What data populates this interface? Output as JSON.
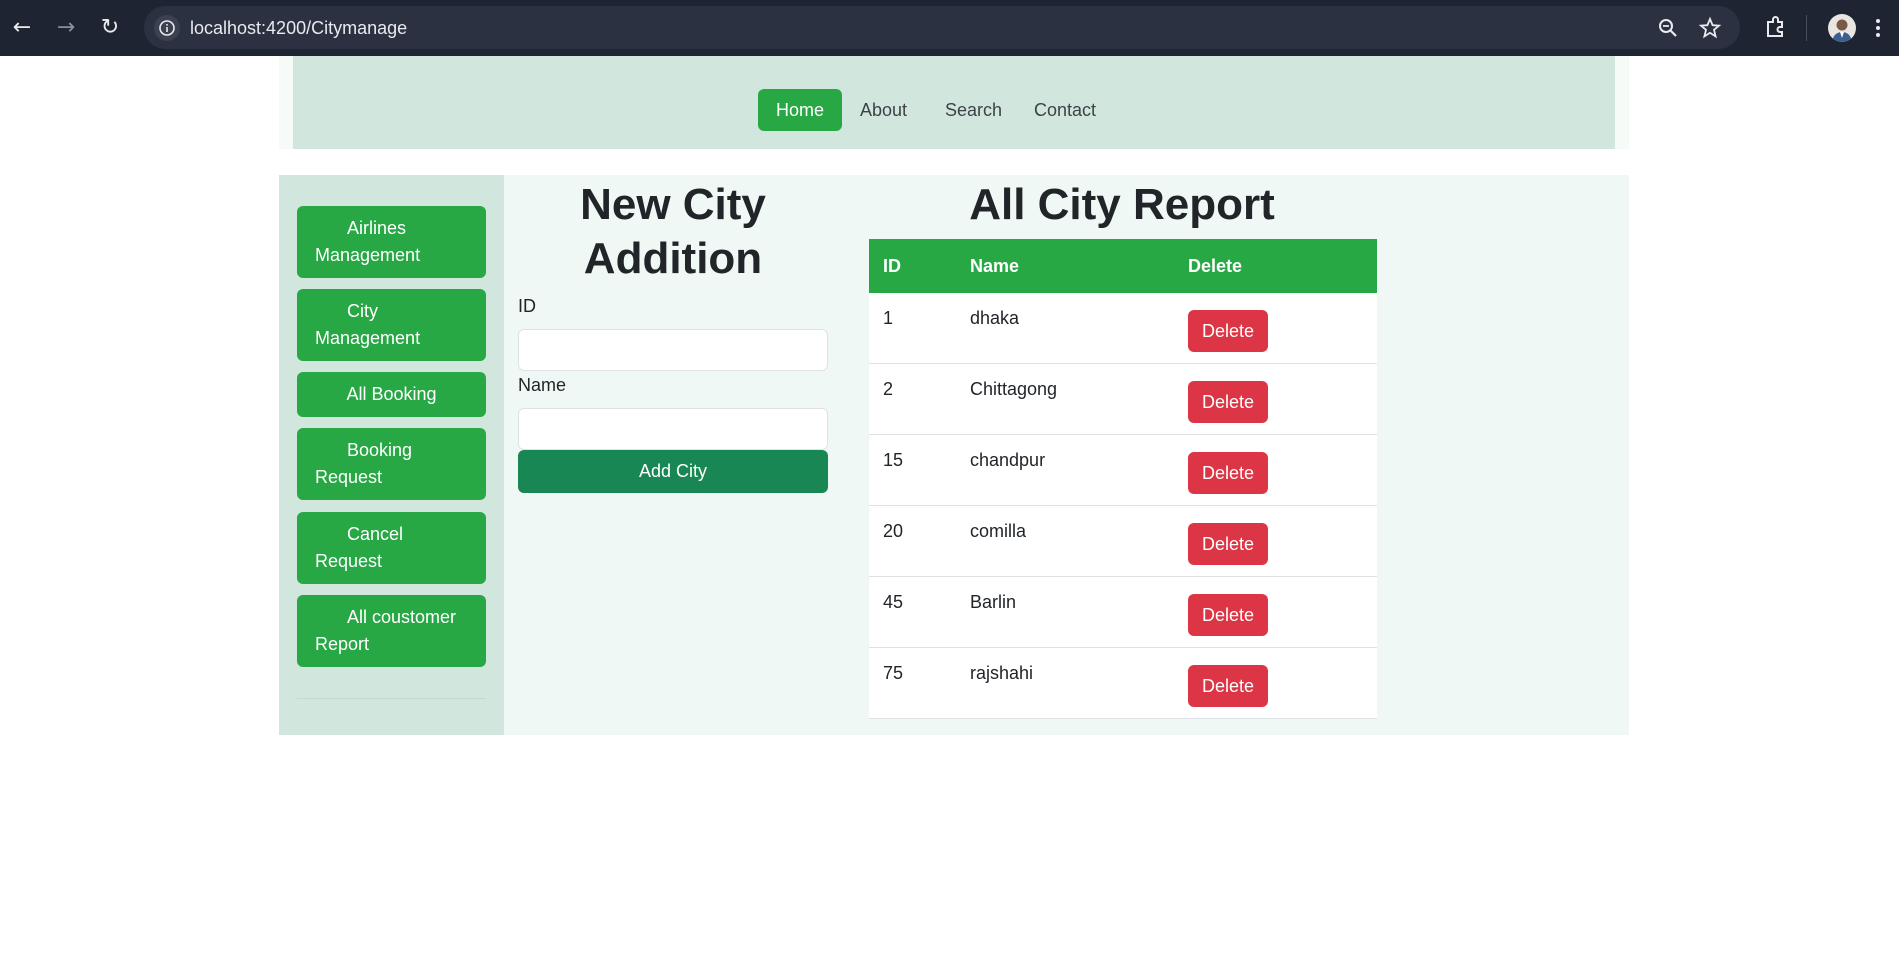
{
  "browser": {
    "url": "localhost:4200/Citymanage",
    "back_icon": "arrow-left-icon",
    "forward_icon": "arrow-right-icon",
    "reload_icon": "reload-icon"
  },
  "navbar": {
    "links": [
      {
        "label": "Home",
        "active": true
      },
      {
        "label": "About",
        "active": false
      },
      {
        "label": "Search",
        "active": false
      },
      {
        "label": "Contact",
        "active": false
      }
    ]
  },
  "sidebar": {
    "items": [
      {
        "label": "Airlines Management"
      },
      {
        "label": "City Management"
      },
      {
        "label": "All Booking"
      },
      {
        "label": "Booking Request"
      },
      {
        "label": "Cancel Request"
      },
      {
        "label": "All coustomer Report"
      }
    ]
  },
  "form": {
    "title": "New City Addition",
    "id_label": "ID",
    "id_value": "",
    "name_label": "Name",
    "name_value": "",
    "submit_label": "Add City"
  },
  "report": {
    "title": "All City Report",
    "columns": [
      "ID",
      "Name",
      "Delete"
    ],
    "rows": [
      {
        "id": "1",
        "name": "dhaka",
        "action": "Delete"
      },
      {
        "id": "2",
        "name": "Chittagong",
        "action": "Delete"
      },
      {
        "id": "15",
        "name": "chandpur",
        "action": "Delete"
      },
      {
        "id": "20",
        "name": "comilla",
        "action": "Delete"
      },
      {
        "id": "45",
        "name": "Barlin",
        "action": "Delete"
      },
      {
        "id": "75",
        "name": "rajshahi",
        "action": "Delete"
      }
    ]
  },
  "colors": {
    "primary_green": "#28a745",
    "dark_green": "#198754",
    "danger_red": "#dc3545",
    "nav_bg": "#d1e7dd",
    "chrome_bg": "#1f2433"
  }
}
